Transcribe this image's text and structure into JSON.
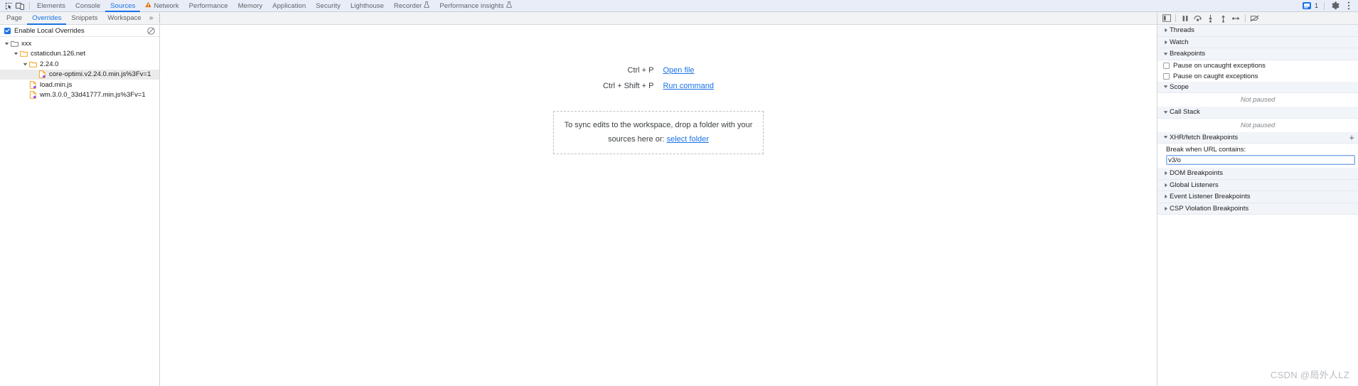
{
  "window": {
    "watermark": "CSDN @局外人LZ"
  },
  "topbar": {
    "icons": [
      {
        "name": "inspect-element-icon",
        "glyph": "cursor-box"
      },
      {
        "name": "device-toolbar-icon",
        "glyph": "device"
      }
    ],
    "tabs": [
      {
        "label": "Elements",
        "active": false,
        "icon": ""
      },
      {
        "label": "Console",
        "active": false,
        "icon": ""
      },
      {
        "label": "Sources",
        "active": true,
        "icon": ""
      },
      {
        "label": "Network",
        "active": false,
        "icon": "warning-triangle-icon"
      },
      {
        "label": "Performance",
        "active": false,
        "icon": ""
      },
      {
        "label": "Memory",
        "active": false,
        "icon": ""
      },
      {
        "label": "Application",
        "active": false,
        "icon": ""
      },
      {
        "label": "Security",
        "active": false,
        "icon": ""
      },
      {
        "label": "Lighthouse",
        "active": false,
        "icon": ""
      },
      {
        "label": "Recorder",
        "active": false,
        "icon": "experiment-flask-icon"
      },
      {
        "label": "Performance insights",
        "active": false,
        "icon": "experiment-flask-icon"
      }
    ],
    "right": {
      "issues_count": "1",
      "settings_icon": "gear-icon",
      "more_icon": "kebab-menu-icon"
    }
  },
  "navigator": {
    "tabs": [
      {
        "label": "Page",
        "active": false
      },
      {
        "label": "Overrides",
        "active": true
      },
      {
        "label": "Snippets",
        "active": false
      },
      {
        "label": "Workspace",
        "active": false
      }
    ],
    "more_label": "»",
    "overrides": {
      "checkbox_label": "Enable Local Overrides",
      "checked": true,
      "clear_icon": "clear-configuration-icon"
    },
    "tree": [
      {
        "label": "xxx",
        "depth": 0,
        "type": "folder",
        "expanded": true,
        "selected": false,
        "folder_style": "grey"
      },
      {
        "label": "cstaticdun.126.net",
        "depth": 1,
        "type": "folder",
        "expanded": true,
        "selected": false,
        "folder_style": "orange"
      },
      {
        "label": "2.24.0",
        "depth": 2,
        "type": "folder",
        "expanded": true,
        "selected": false,
        "folder_style": "orange"
      },
      {
        "label": "core-optimi.v2.24.0.min.js%3Fv=1",
        "depth": 3,
        "type": "file",
        "expanded": false,
        "selected": true,
        "folder_style": ""
      },
      {
        "label": "load.min.js",
        "depth": 2,
        "type": "file",
        "expanded": false,
        "selected": false,
        "folder_style": ""
      },
      {
        "label": "wm.3.0.0_33d41777.min.js%3Fv=1",
        "depth": 2,
        "type": "file",
        "expanded": false,
        "selected": false,
        "folder_style": ""
      }
    ]
  },
  "editor": {
    "toolbar": {
      "show_navigator_icon": "show-navigator-panel-icon"
    },
    "shortcuts": [
      {
        "keys": "Ctrl + P",
        "action": "Open file"
      },
      {
        "keys": "Ctrl + Shift + P",
        "action": "Run command"
      }
    ],
    "dropzone": {
      "text_before": "To sync edits to the workspace, drop a folder with your sources here or:",
      "line1": "To sync edits to the workspace, drop a folder with your",
      "line2_prefix": "sources here or:",
      "link": "select folder"
    }
  },
  "debugger": {
    "toolbar_icons": [
      {
        "name": "pause-script-execution-icon"
      },
      {
        "name": "step-over-icon"
      },
      {
        "name": "step-into-icon"
      },
      {
        "name": "step-out-icon"
      },
      {
        "name": "step-icon"
      },
      {
        "name": "deactivate-breakpoints-icon"
      }
    ],
    "sections": [
      {
        "title": "Threads",
        "expanded": false,
        "type": "plain"
      },
      {
        "title": "Watch",
        "expanded": false,
        "type": "plain"
      },
      {
        "title": "Breakpoints",
        "expanded": true,
        "type": "breakpoints"
      },
      {
        "title": "Scope",
        "expanded": true,
        "type": "notpaused"
      },
      {
        "title": "Call Stack",
        "expanded": true,
        "type": "notpaused"
      },
      {
        "title": "XHR/fetch Breakpoints",
        "expanded": true,
        "type": "xhr",
        "add_button": "+"
      },
      {
        "title": "DOM Breakpoints",
        "expanded": false,
        "type": "plain"
      },
      {
        "title": "Global Listeners",
        "expanded": false,
        "type": "plain"
      },
      {
        "title": "Event Listener Breakpoints",
        "expanded": false,
        "type": "plain"
      },
      {
        "title": "CSP Violation Breakpoints",
        "expanded": false,
        "type": "plain"
      }
    ],
    "breakpoints": {
      "pause_uncaught_label": "Pause on uncaught exceptions",
      "pause_uncaught_checked": false,
      "pause_caught_label": "Pause on caught exceptions",
      "pause_caught_checked": false
    },
    "scope_status": "Not paused",
    "callstack_status": "Not paused",
    "xhr": {
      "prompt": "Break when URL contains:",
      "value": "v3/o",
      "placeholder": "Break when URL contains:"
    }
  },
  "colors": {
    "accent": "#1a73e8",
    "toolbar_bg": "#e9edf7",
    "panel_bg": "#f1f3f4",
    "section_bg": "#f1f4f9",
    "folder_orange": "#f29900",
    "warning_orange": "#e8710a",
    "text": "#202124",
    "muted": "#80868b"
  }
}
